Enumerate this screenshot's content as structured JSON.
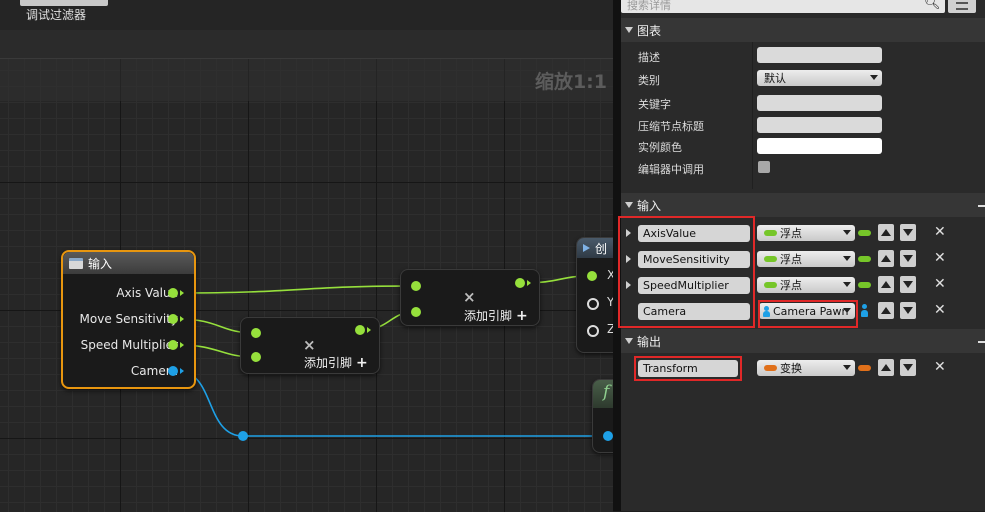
{
  "toolbar": {
    "debug_filter_label": "调试过滤器"
  },
  "graph": {
    "zoom_label": "缩放1:1",
    "input_node": {
      "title": "输入",
      "pins": [
        {
          "label": "Axis Value",
          "type": "float"
        },
        {
          "label": "Move Sensitivity",
          "type": "float"
        },
        {
          "label": "Speed Multiplier",
          "type": "float"
        },
        {
          "label": "Camera",
          "type": "object"
        }
      ]
    },
    "multiply_node_1": {
      "op": "×",
      "add_pin_label": "添加引脚",
      "add_icon": "+"
    },
    "multiply_node_2": {
      "op": "×",
      "add_pin_label": "添加引脚",
      "add_icon": "+"
    },
    "make_vector_node": {
      "title_fragment": "创",
      "pins": [
        "X",
        "Y",
        "Z"
      ]
    },
    "function_node": {
      "title_fragment": "f"
    }
  },
  "details": {
    "search_placeholder": "搜索详情",
    "graph_section": {
      "title": "图表",
      "rows": [
        {
          "label": "描述",
          "value": ""
        },
        {
          "label": "类别",
          "value": "默认"
        },
        {
          "label": "关键字",
          "value": ""
        },
        {
          "label": "压缩节点标题",
          "value": ""
        },
        {
          "label": "实例颜色",
          "value": ""
        },
        {
          "label": "编辑器中调用",
          "value": ""
        }
      ]
    },
    "inputs_section": {
      "title": "输入",
      "rows": [
        {
          "name": "AxisValue",
          "type": "浮点",
          "color": "#76c629"
        },
        {
          "name": "MoveSensitivity",
          "type": "浮点",
          "color": "#76c629"
        },
        {
          "name": "SpeedMultiplier",
          "type": "浮点",
          "color": "#76c629"
        },
        {
          "name": "Camera",
          "type": "Camera Pawn",
          "color": "#1ea0e6"
        }
      ]
    },
    "outputs_section": {
      "title": "输出",
      "rows": [
        {
          "name": "Transform",
          "type": "变换",
          "color": "#e0701a"
        }
      ]
    }
  },
  "colors": {
    "highlight": "#e02828",
    "selection": "#e8960f",
    "float_pin": "#96e03c",
    "object_pin": "#1ea0e6"
  }
}
